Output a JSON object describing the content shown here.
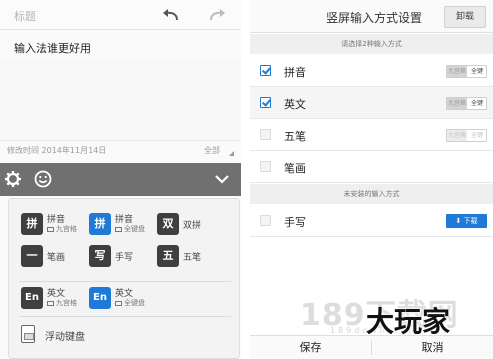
{
  "left": {
    "note": {
      "title_placeholder": "标题",
      "body": "输入法谁更好用",
      "modified": "修改时间 2014年11月14日",
      "all_label": "全部"
    },
    "ime_options": [
      {
        "glyph": "拼",
        "name": "拼音",
        "sub": "九宫格",
        "tile": "dark"
      },
      {
        "glyph": "拼",
        "name": "拼音",
        "sub": "全键盘",
        "tile": "blue"
      },
      {
        "glyph": "双",
        "name": "双拼",
        "sub": "",
        "tile": "dark"
      },
      {
        "glyph": "一",
        "name": "笔画",
        "sub": "",
        "tile": "dark"
      },
      {
        "glyph": "写",
        "name": "手写",
        "sub": "",
        "tile": "dark"
      },
      {
        "glyph": "五",
        "name": "五笔",
        "sub": "",
        "tile": "dark"
      },
      {
        "glyph": "En",
        "name": "英文",
        "sub": "九宫格",
        "tile": "dark"
      },
      {
        "glyph": "En",
        "name": "英文",
        "sub": "全键盘",
        "tile": "blue"
      }
    ],
    "floating_keyboard": "浮动键盘"
  },
  "right": {
    "title": "竖屏输入方式设置",
    "uninstall": "卸载",
    "hint_select": "请选择2种输入方式",
    "installed": [
      {
        "name": "拼音",
        "checked": true,
        "seg_left": "九宫格",
        "seg_right": "全键",
        "dim": false
      },
      {
        "name": "英文",
        "checked": true,
        "seg_left": "九宫格",
        "seg_right": "全键",
        "dim": false
      },
      {
        "name": "五笔",
        "checked": false,
        "seg_left": "九宫格",
        "seg_right": "全键",
        "dim": true
      },
      {
        "name": "笔画",
        "checked": false
      }
    ],
    "hint_uninstalled": "未安装的输入方式",
    "uninstalled": [
      {
        "name": "手写",
        "action": "下载"
      }
    ],
    "save": "保存",
    "cancel": "取消"
  },
  "watermark": {
    "site": "189下载网",
    "url": "189down.com",
    "brand": "大玩家"
  },
  "colors": {
    "accent_blue": "#1e7ad6",
    "toolbar_gray": "#707070",
    "tile_dark": "#3f3f3f"
  }
}
